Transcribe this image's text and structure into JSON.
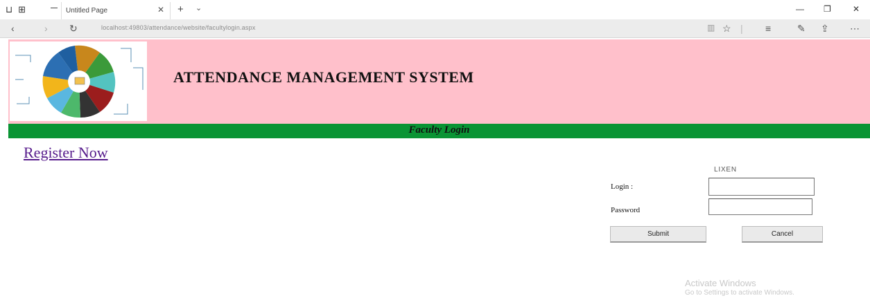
{
  "browser": {
    "tab_title": "Untitled Page",
    "address": "localhost:49803/attendance/website/facultylogin.aspx"
  },
  "header": {
    "title": "ATTENDANCE MANAGEMENT SYSTEM",
    "subtitle": "Faculty Login"
  },
  "register_link": "Register Now",
  "form": {
    "error_text": "LIXEN",
    "login_label": "Login :",
    "password_label": "Password",
    "login_value": "",
    "password_value": "",
    "submit_label": "Submit",
    "cancel_label": "Cancel"
  },
  "watermark": {
    "line1": "Activate Windows",
    "line2": "Go to Settings to activate Windows."
  },
  "colors": {
    "header_bg": "#ffc0cb",
    "bar_bg": "#0a9434",
    "link": "#551a8b"
  }
}
